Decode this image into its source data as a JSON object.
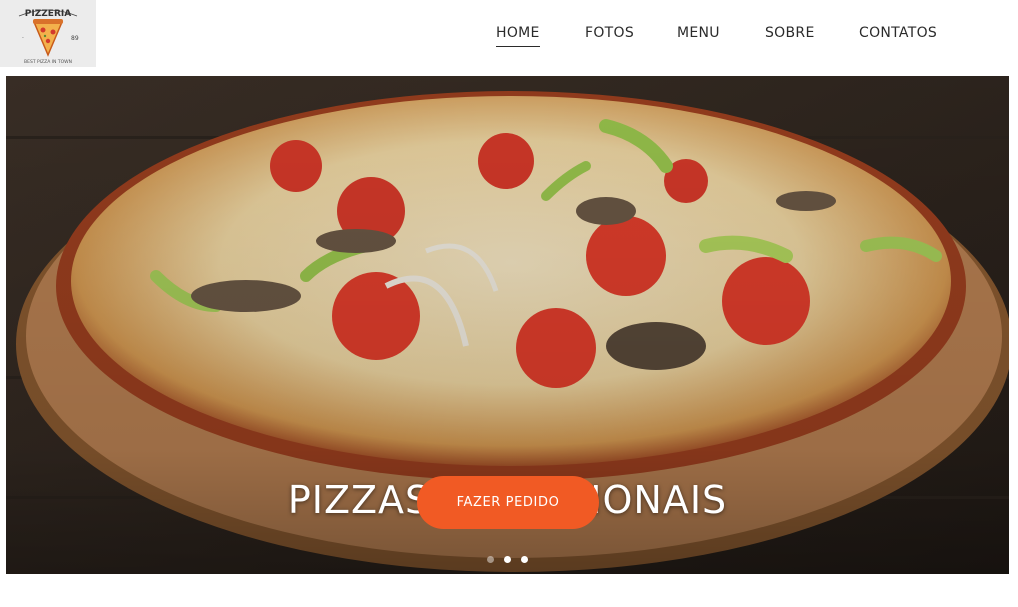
{
  "logo": {
    "title": "PIZZERIA",
    "est_left": "·",
    "est_right": "89",
    "tagline": "BEST PIZZA IN TOWN",
    "icon": "pizza-slice-icon"
  },
  "nav": {
    "items": [
      {
        "label": "HOME",
        "active": true
      },
      {
        "label": "FOTOS",
        "active": false
      },
      {
        "label": "MENU",
        "active": false
      },
      {
        "label": "SOBRE",
        "active": false
      },
      {
        "label": "CONTATOS",
        "active": false
      }
    ]
  },
  "hero": {
    "title": "PIZZAS TRADICIONAIS",
    "button_label": "FAZER PEDIDO",
    "slides_total": 3,
    "active_slide": 1
  },
  "colors": {
    "accent": "#f15a24",
    "nav_text": "#2b2b2b",
    "hero_text": "#ffffff"
  }
}
